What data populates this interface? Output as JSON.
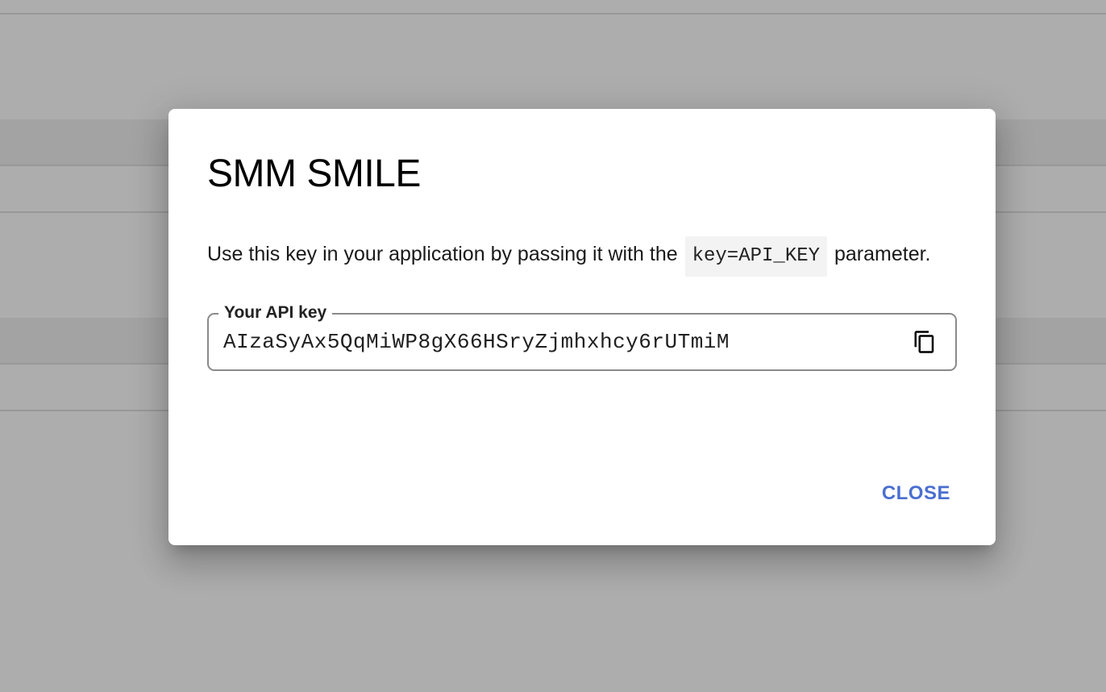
{
  "dialog": {
    "title": "SMM SMILE",
    "description_before": "Use this key in your application by passing it with the",
    "description_code": "key=API_KEY",
    "description_after": "parameter.",
    "field_label": "Your API key",
    "api_key": "AIzaSyAx5QqMiWP8gX66HSryZjmhxhcy6rUTmiM",
    "copy_icon": "content-copy-icon",
    "close_label": "CLOSE"
  },
  "colors": {
    "accent": "#4a6fd0",
    "scrim": "rgba(0,0,0,0.32)"
  }
}
